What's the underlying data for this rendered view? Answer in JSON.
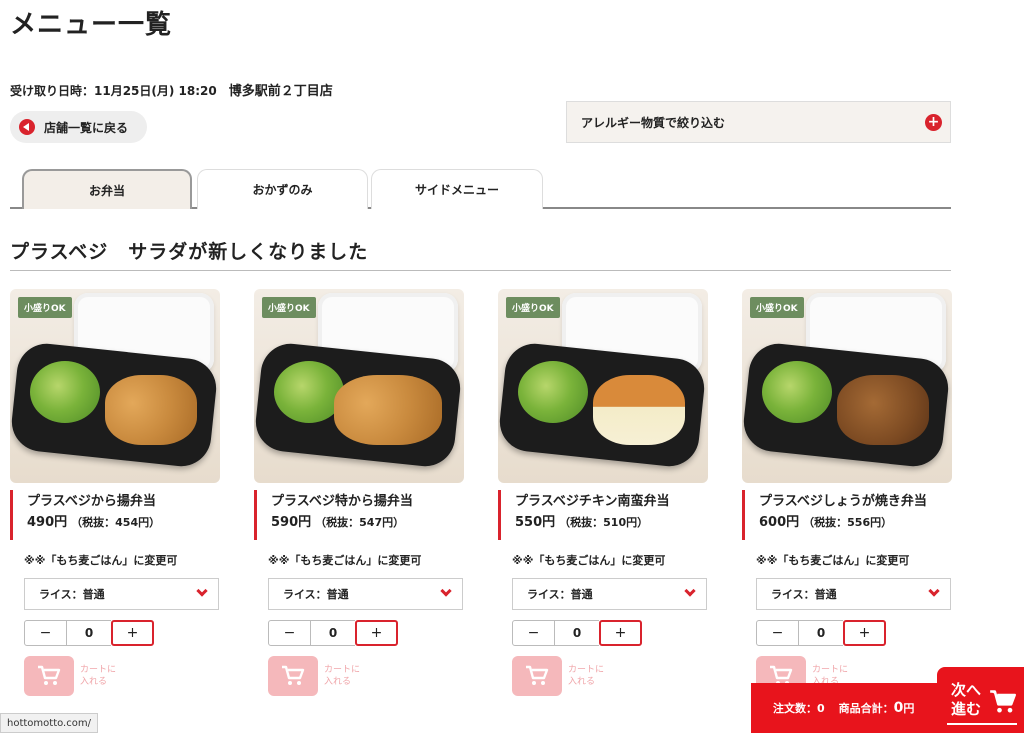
{
  "page": {
    "title": "メニュー一覧",
    "pickup_label": "受け取り日時：11月25日(月) 18:20",
    "store_name": "博多駅前２丁目店",
    "back_label": "店舗一覧に戻る",
    "allergy_label": "アレルギー物質で絞り込む"
  },
  "tabs": [
    {
      "label": "お弁当",
      "active": true
    },
    {
      "label": "おかずのみ",
      "active": false
    },
    {
      "label": "サイドメニュー",
      "active": false
    }
  ],
  "section": {
    "title": "プラスベジ　サラダが新しくなりました"
  },
  "items": [
    {
      "badge": "小盛りOK",
      "name": "プラスベジから揚弁当",
      "price": "490",
      "yen": "円",
      "tax": "（税抜：454円）",
      "note": "※※「もち麦ごはん」に変更可",
      "rice_option": "ライス：普通",
      "qty": "0",
      "cart_label_1": "カートに",
      "cart_label_2": "入れる",
      "dish": "karaage"
    },
    {
      "badge": "小盛りOK",
      "name": "プラスベジ特から揚弁当",
      "price": "590",
      "yen": "円",
      "tax": "（税抜：547円）",
      "note": "※※「もち麦ごはん」に変更可",
      "rice_option": "ライス：普通",
      "qty": "0",
      "cart_label_1": "カートに",
      "cart_label_2": "入れる",
      "dish": "karaage"
    },
    {
      "badge": "小盛りOK",
      "name": "プラスベジチキン南蛮弁当",
      "price": "550",
      "yen": "円",
      "tax": "（税抜：510円）",
      "note": "※※「もち麦ごはん」に変更可",
      "rice_option": "ライス：普通",
      "qty": "0",
      "cart_label_1": "カートに",
      "cart_label_2": "入れる",
      "dish": "nanban"
    },
    {
      "badge": "小盛りOK",
      "name": "プラスベジしょうが焼き弁当",
      "price": "600",
      "yen": "円",
      "tax": "（税抜：556円）",
      "note": "※※「もち麦ごはん」に変更可",
      "rice_option": "ライス：普通",
      "qty": "0",
      "cart_label_1": "カートに",
      "cart_label_2": "入れる",
      "dish": "shoga"
    }
  ],
  "stepper": {
    "minus": "−",
    "plus": "+"
  },
  "footer": {
    "order_count": "注文数：0",
    "subtotal_label": "商品合計：",
    "subtotal_value": "0",
    "subtotal_yen": "円",
    "next_line1": "次へ",
    "next_line2": "進む"
  },
  "status_url": "hottomotto.com/",
  "colors": {
    "accent": "#d9232d",
    "badge": "#6d8d5f",
    "footer": "#e8141c"
  },
  "icons": [
    "back-arrow-icon",
    "plus-circle-icon",
    "chevron-down-icon",
    "cart-icon"
  ]
}
